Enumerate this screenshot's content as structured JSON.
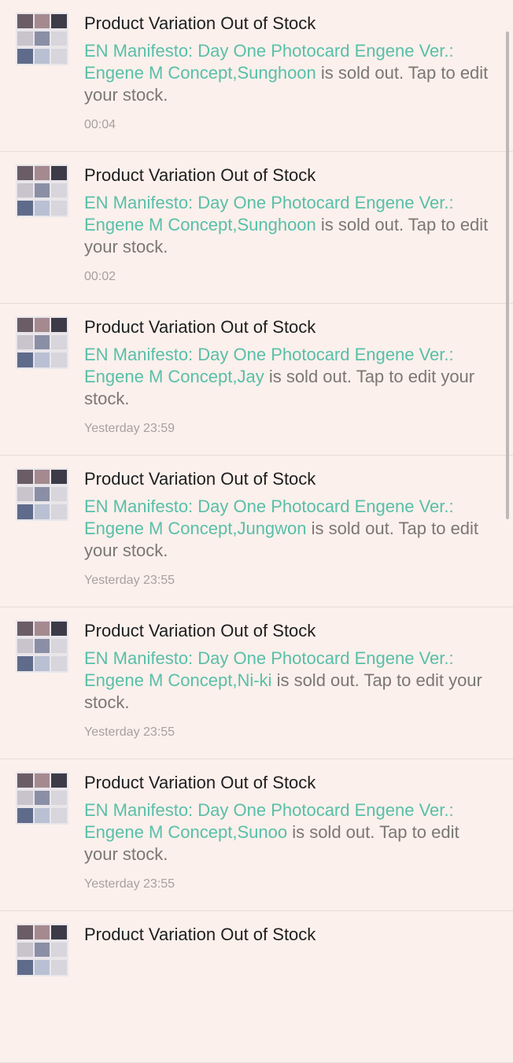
{
  "notifications": [
    {
      "title": "Product Variation Out of Stock",
      "product": "EN Manifesto: Day One Photocard Engene Ver.: Engene M Concept,Sunghoon",
      "suffix": " is sold out. Tap to edit your stock.",
      "time": "00:04"
    },
    {
      "title": "Product Variation Out of Stock",
      "product": "EN Manifesto: Day One Photocard Engene Ver.: Engene M Concept,Sunghoon",
      "suffix": " is sold out. Tap to edit your stock.",
      "time": "00:02"
    },
    {
      "title": "Product Variation Out of Stock",
      "product": "EN Manifesto: Day One Photocard Engene Ver.: Engene M Concept,Jay",
      "suffix": " is sold out. Tap to edit your stock.",
      "time": "Yesterday 23:59"
    },
    {
      "title": "Product Variation Out of Stock",
      "product": "EN Manifesto: Day One Photocard Engene Ver.: Engene M Concept,Jungwon",
      "suffix": " is sold out. Tap to edit your stock.",
      "time": "Yesterday 23:55"
    },
    {
      "title": "Product Variation Out of Stock",
      "product": "EN Manifesto: Day One Photocard Engene Ver.: Engene M Concept,Ni-ki",
      "suffix": " is sold out. Tap to edit your stock.",
      "time": "Yesterday 23:55"
    },
    {
      "title": "Product Variation Out of Stock",
      "product": "EN Manifesto: Day One Photocard Engene Ver.: Engene M Concept,Sunoo",
      "suffix": " is sold out. Tap to edit your stock.",
      "time": "Yesterday 23:55"
    },
    {
      "title": "Product Variation Out of Stock",
      "product": "",
      "suffix": "",
      "time": ""
    }
  ],
  "colors": {
    "background": "#fbf0ec",
    "product_link": "#58bfa8",
    "body_text": "#7c7772",
    "time_text": "#a8a19d"
  }
}
